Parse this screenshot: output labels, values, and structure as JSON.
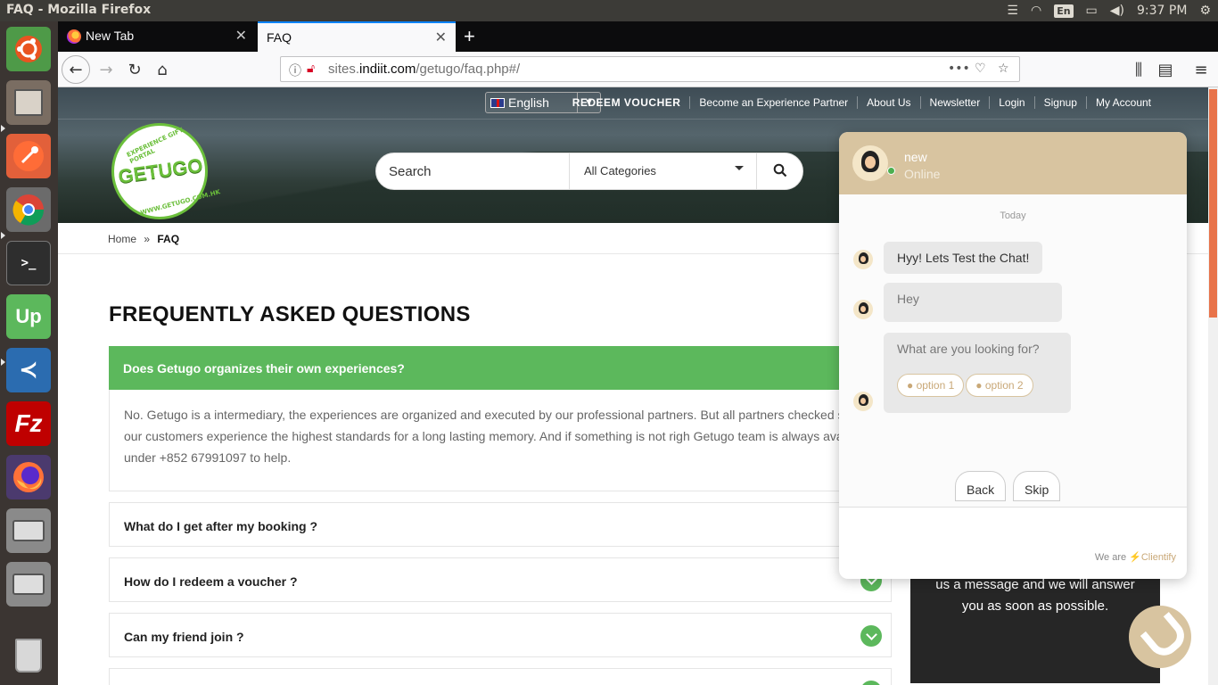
{
  "window": {
    "title": "FAQ - Mozilla Firefox",
    "time": "9:37 PM",
    "keyboard": "En"
  },
  "tabs": [
    {
      "label": "New Tab"
    },
    {
      "label": "FAQ"
    }
  ],
  "url": {
    "prefix": "sites.",
    "domain": "indiit.com",
    "path": "/getugo/faq.php#/"
  },
  "header": {
    "language": "English",
    "links": [
      "REDEEM VOUCHER",
      "Become an Experience Partner",
      "About Us",
      "Newsletter",
      "Login",
      "Signup",
      "My Account"
    ],
    "logo": {
      "name": "GETUGO",
      "tagline": "EXPERIENCE GIFT PORTAL",
      "site": "WWW.GETUGO.COM.HK"
    },
    "search": {
      "placeholder": "Search",
      "category": "All Categories"
    }
  },
  "breadcrumb": {
    "home": "Home",
    "separator": "»",
    "current": "FAQ"
  },
  "faq": {
    "title": "FREQUENTLY ASKED QUESTIONS",
    "open_question": "Does Getugo organizes their own experiences?",
    "open_answer": "No. Getugo is a intermediary, the experiences are organized and executed by our professional partners. But all partners checked so that our customers experience the highest standards for a long lasting memory. And if something is not righ Getugo team is always available under +852 67991097 to help.",
    "questions": [
      "What do I get after my booking ?",
      "How do I redeem a voucher ?",
      "Can my friend join ?"
    ]
  },
  "side_panel": {
    "text": "us a message and we will answer you as soon as possible."
  },
  "chat": {
    "agent_name": "new",
    "status": "Online",
    "day_label": "Today",
    "messages": [
      "Hyy! Lets Test the Chat!",
      "Hey",
      "What are you looking for?"
    ],
    "options": [
      "● option 1",
      "● option 2"
    ],
    "back_label": "Back",
    "skip_label": "Skip",
    "footer_prefix": "We are",
    "footer_brand": "⚡Clientify"
  },
  "colors": {
    "accent_green": "#5cb85c",
    "chat_tan": "#d8c4a0",
    "ubuntu_panel": "#3c3b37"
  }
}
